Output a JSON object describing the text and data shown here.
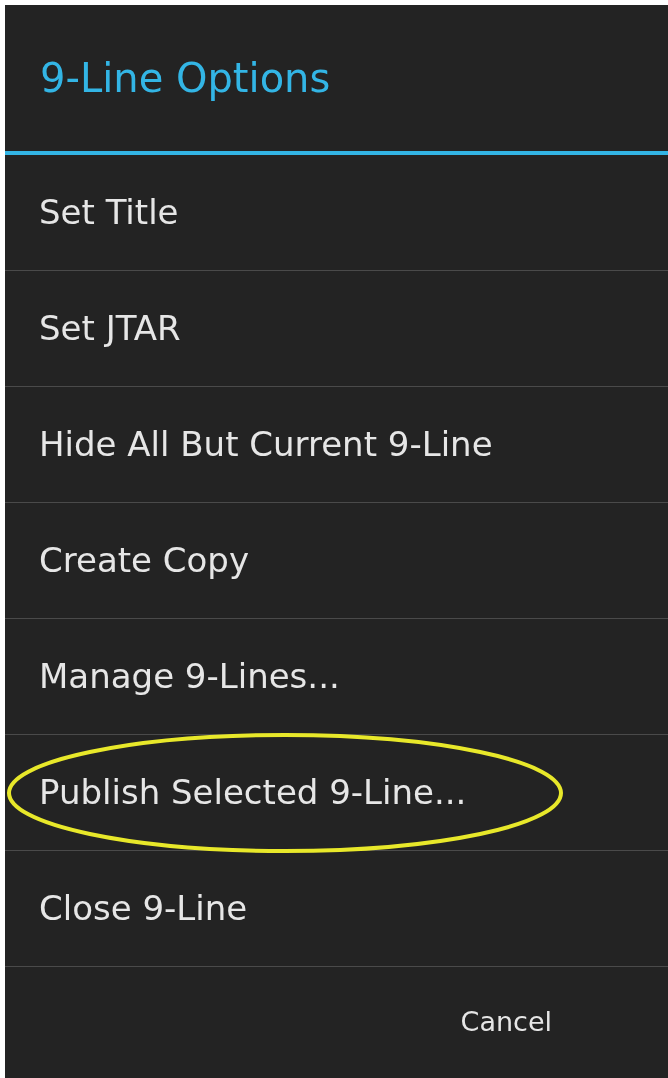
{
  "dialog": {
    "title": "9-Line Options"
  },
  "items": [
    {
      "label": "Set Title",
      "circled": false
    },
    {
      "label": "Set JTAR",
      "circled": false
    },
    {
      "label": "Hide All But Current 9-Line",
      "circled": false
    },
    {
      "label": "Create Copy",
      "circled": false
    },
    {
      "label": "Manage 9-Lines...",
      "circled": false
    },
    {
      "label": "Publish Selected 9-Line...",
      "circled": true
    },
    {
      "label": "Close 9-Line",
      "circled": false
    }
  ],
  "buttons": [
    "Cancel"
  ]
}
